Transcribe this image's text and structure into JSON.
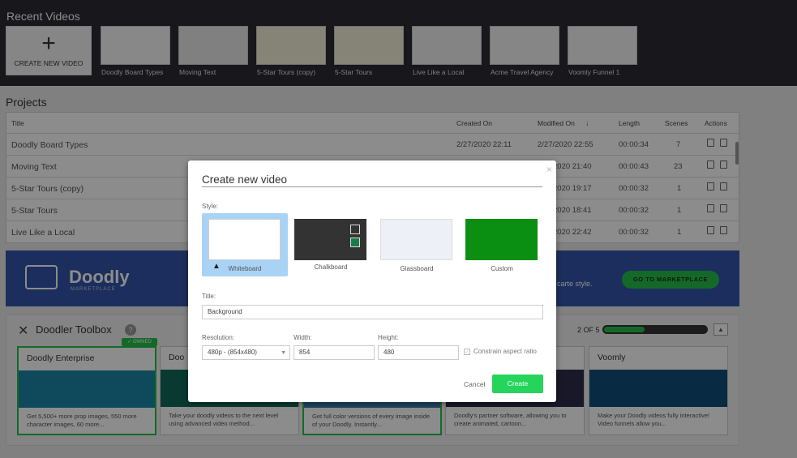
{
  "recent": {
    "title": "Recent Videos",
    "create_label": "CREATE NEW VIDEO",
    "videos": [
      {
        "label": "Doodly Board Types"
      },
      {
        "label": "Moving Text"
      },
      {
        "label": "5-Star Tours (copy)"
      },
      {
        "label": "5-Star Tours"
      },
      {
        "label": "Live Like a Local"
      },
      {
        "label": "Acme Travel Agency"
      },
      {
        "label": "Voomly Funnel 1"
      }
    ]
  },
  "projects": {
    "title": "Projects",
    "columns": [
      "Title",
      "Created On",
      "Modified On",
      "Length",
      "Scenes",
      "Actions"
    ],
    "sort_arrow": "↓",
    "rows": [
      {
        "title": "Doodly Board Types",
        "created": "2/27/2020 22:11",
        "modified": "2/27/2020 22:55",
        "length": "00:00:34",
        "scenes": "7"
      },
      {
        "title": "Moving Text",
        "created": "",
        "modified": "2020 21:40",
        "length": "00:00:43",
        "scenes": "23"
      },
      {
        "title": "5-Star Tours (copy)",
        "created": "",
        "modified": "2020 19:17",
        "length": "00:00:32",
        "scenes": "1"
      },
      {
        "title": "5-Star Tours",
        "created": "",
        "modified": "2020 18:41",
        "length": "00:00:32",
        "scenes": "1"
      },
      {
        "title": "Live Like a Local",
        "created": "",
        "modified": "2020 22:42",
        "length": "00:00:32",
        "scenes": "1"
      }
    ]
  },
  "banner": {
    "logo": "Doodly",
    "logo_sub": "MARKETPLACE",
    "tail_text": "carte style.",
    "button": "GO TO MARKETPLACE"
  },
  "toolbox": {
    "title": "Doodler Toolbox",
    "help": "?",
    "pager": "2 OF 5",
    "pager_progress": 0.4,
    "owned_badge": "✓ OWNED",
    "cards": [
      {
        "title": "Doodly Enterprise",
        "desc": "Get 5,500+ more prop images, 550 more character images, 60 more..."
      },
      {
        "title": "Doo",
        "desc": "Take your doodly videos to the next level using advanced video method..."
      },
      {
        "title": "",
        "desc": "Get full color versions of every image inside of your Doodly. Instantly..."
      },
      {
        "title": "",
        "desc": "Doodly's partner software, allowing you to create animated, cartoon..."
      },
      {
        "title": "Voomly",
        "desc": "Make your Doodly videos fully interactive! Video funnels allow you..."
      }
    ]
  },
  "modal": {
    "title": "Create new video",
    "close": "×",
    "style_label": "Style:",
    "styles": [
      {
        "label": "Whiteboard",
        "color": "#ffffff",
        "selected": true
      },
      {
        "label": "Chalkboard",
        "color": "#333333",
        "selected": false
      },
      {
        "label": "Glassboard",
        "color": "#eef0f8",
        "selected": false
      },
      {
        "label": "Custom",
        "color": "#0a8f12",
        "selected": false
      }
    ],
    "title_label": "Title:",
    "title_value": "Background",
    "resolution_label": "Resolution:",
    "resolution_value": "480p  -  (854x480)",
    "width_label": "Width:",
    "width_value": "854",
    "height_label": "Height:",
    "height_value": "480",
    "constrain_label": "Constrain aspect ratio",
    "cancel": "Cancel",
    "create": "Create"
  },
  "colors": {
    "accent_green": "#25c04b",
    "header_dark": "#2b2b33",
    "banner_blue": "#3454a9"
  }
}
